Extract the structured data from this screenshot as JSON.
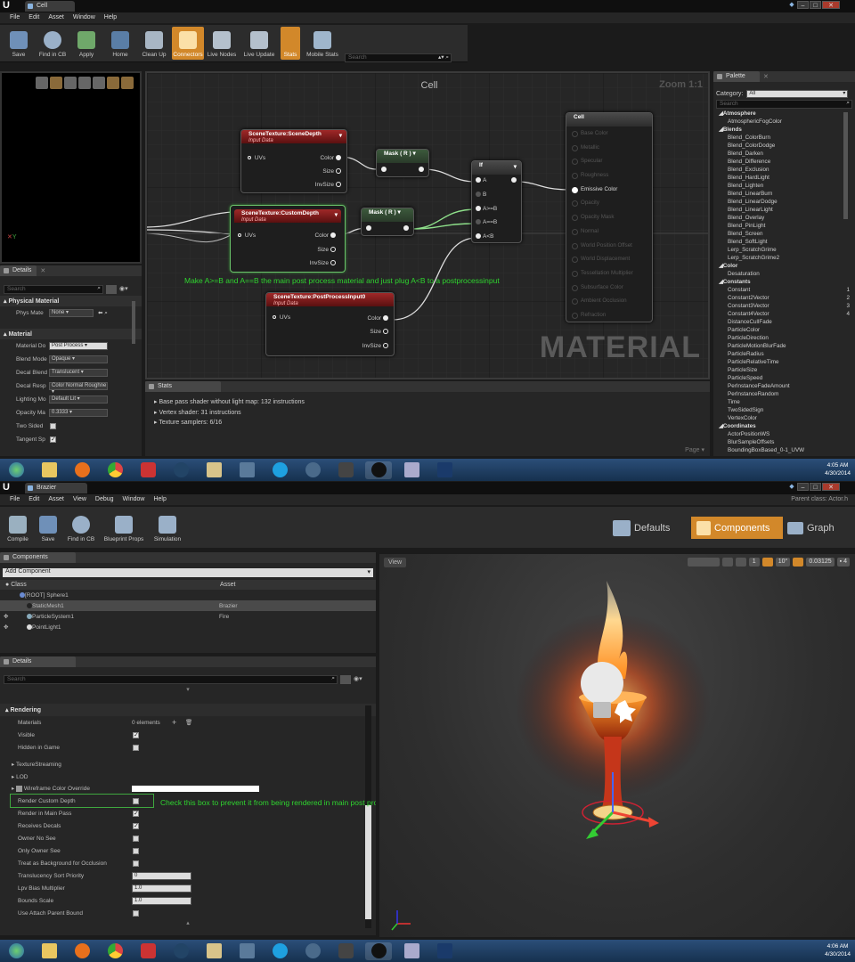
{
  "top": {
    "tab_title": "Cell",
    "menu": [
      "File",
      "Edit",
      "Asset",
      "Window",
      "Help"
    ],
    "toolbar": [
      "Save",
      "Find in CB",
      "Apply",
      "Home",
      "Clean Up",
      "Connectors",
      "Live Nodes",
      "Live Update",
      "Stats",
      "Mobile Stats"
    ],
    "toolbar_search_placeholder": "Search",
    "graph_title": "Cell",
    "zoom": "Zoom 1:1",
    "watermark": "MATERIAL",
    "annotation": "Make A>=B and A==B the main post process material and just plug A<B to a postprocessinput",
    "nodes": {
      "scene_depth": {
        "title": "SceneTexture:SceneDepth",
        "sub": "Input Data",
        "pins": [
          "UVs",
          "Color",
          "Size",
          "InvSize"
        ]
      },
      "custom_depth": {
        "title": "SceneTexture:CustomDepth",
        "sub": "Input Data",
        "pins": [
          "UVs",
          "Color",
          "Size",
          "InvSize"
        ]
      },
      "post_process": {
        "title": "SceneTexture:PostProcessInput0",
        "sub": "Input Data",
        "pins": [
          "UVs",
          "Color",
          "Size",
          "InvSize"
        ]
      },
      "mask1": {
        "title": "Mask ( R )"
      },
      "mask2": {
        "title": "Mask ( R )"
      },
      "if": {
        "title": "If",
        "pins": [
          "A",
          "B",
          "A>=B",
          "A==B",
          "A<B"
        ]
      },
      "cell": {
        "title": "Cell",
        "pins": [
          "Base Color",
          "Metallic",
          "Specular",
          "Roughness",
          "Emissive Color",
          "Opacity",
          "Opacity Mask",
          "Normal",
          "World Position Offset",
          "World Displacement",
          "Tessellation Multiplier",
          "Subsurface Color",
          "Ambient Occlusion",
          "Refraction"
        ]
      }
    },
    "details": {
      "tab": "Details",
      "search_placeholder": "Search",
      "cat_physical": "Physical Material",
      "phys_label": "Phys Mate",
      "phys_value": "None",
      "cat_material": "Material",
      "rows": [
        {
          "label": "Material Do",
          "value": "Post Process"
        },
        {
          "label": "Blend Mode",
          "value": "Opaque"
        },
        {
          "label": "Decal Blend",
          "value": "Translucent"
        },
        {
          "label": "Decal Resp",
          "value": "Color Normal Roughne"
        },
        {
          "label": "Lighting Mo",
          "value": "Default Lit"
        },
        {
          "label": "Opacity Ma",
          "value": "0.3333"
        },
        {
          "label": "Two Sided",
          "value": ""
        },
        {
          "label": "Tangent Sp",
          "value": ""
        }
      ]
    },
    "stats": {
      "tab": "Stats",
      "lines": [
        "Base pass shader without light map: 132 instructions",
        "Vertex shader: 31 instructions",
        "Texture samplers: 6/16"
      ],
      "page": "Page"
    },
    "palette": {
      "tab": "Palette",
      "category_label": "Category:",
      "category_value": "All",
      "search_placeholder": "Search",
      "items": [
        {
          "t": "Atmosphere",
          "cat": true
        },
        {
          "t": "AtmosphericFogColor"
        },
        {
          "t": "Blends",
          "cat": true
        },
        {
          "t": "Blend_ColorBurn"
        },
        {
          "t": "Blend_ColorDodge"
        },
        {
          "t": "Blend_Darken"
        },
        {
          "t": "Blend_Difference"
        },
        {
          "t": "Blend_Exclusion"
        },
        {
          "t": "Blend_HardLight"
        },
        {
          "t": "Blend_Lighten"
        },
        {
          "t": "Blend_LinearBurn"
        },
        {
          "t": "Blend_LinearDodge"
        },
        {
          "t": "Blend_LinearLight"
        },
        {
          "t": "Blend_Overlay"
        },
        {
          "t": "Blend_PinLight"
        },
        {
          "t": "Blend_Screen"
        },
        {
          "t": "Blend_SoftLight"
        },
        {
          "t": "Lerp_ScratchGrime"
        },
        {
          "t": "Lerp_ScratchGrime2"
        },
        {
          "t": "Color",
          "cat": true
        },
        {
          "t": "Desaturation"
        },
        {
          "t": "Constants",
          "cat": true
        },
        {
          "t": "Constant",
          "k": "1"
        },
        {
          "t": "Constant2Vector",
          "k": "2"
        },
        {
          "t": "Constant3Vector",
          "k": "3"
        },
        {
          "t": "Constant4Vector",
          "k": "4"
        },
        {
          "t": "DistanceCullFade"
        },
        {
          "t": "ParticleColor"
        },
        {
          "t": "ParticleDirection"
        },
        {
          "t": "ParticleMotionBlurFade"
        },
        {
          "t": "ParticleRadius"
        },
        {
          "t": "ParticleRelativeTime"
        },
        {
          "t": "ParticleSize"
        },
        {
          "t": "ParticleSpeed"
        },
        {
          "t": "PerInstanceFadeAmount"
        },
        {
          "t": "PerInstanceRandom"
        },
        {
          "t": "Time"
        },
        {
          "t": "TwoSidedSign"
        },
        {
          "t": "VertexColor"
        },
        {
          "t": "Coordinates",
          "cat": true
        },
        {
          "t": "ActorPositionWS"
        },
        {
          "t": "BlurSampleOffsets"
        },
        {
          "t": "BoundingBoxBased_0-1_UVW"
        }
      ]
    },
    "clock": {
      "time": "4:05 AM",
      "date": "4/30/2014"
    }
  },
  "bottom": {
    "tab_title": "Brazier",
    "parent_class": "Parent class: Actor.h",
    "menu": [
      "File",
      "Edit",
      "Asset",
      "View",
      "Debug",
      "Window",
      "Help"
    ],
    "toolbar": [
      "Compile",
      "Save",
      "Find in CB",
      "Blueprint Props",
      "Simulation"
    ],
    "modes": [
      "Defaults",
      "Components",
      "Graph"
    ],
    "components": {
      "tab": "Components",
      "add": "Add Component",
      "col_class": "Class",
      "col_asset": "Asset",
      "tree": [
        {
          "name": "[ROOT] Sphere1",
          "asset": ""
        },
        {
          "name": "StaticMesh1",
          "asset": "Brazier"
        },
        {
          "name": "ParticleSystem1",
          "asset": "Fire"
        },
        {
          "name": "PointLight1",
          "asset": ""
        }
      ]
    },
    "details": {
      "tab": "Details",
      "search_placeholder": "Search",
      "cat": "Rendering",
      "materials_label": "Materials",
      "materials_value": "0 elements",
      "rows": [
        {
          "label": "Visible",
          "check": true
        },
        {
          "label": "Hidden in Game",
          "check": false
        }
      ],
      "groups": [
        "TextureStreaming",
        "LOD",
        "Wireframe Color Override"
      ],
      "rows2": [
        {
          "label": "Render Custom Depth",
          "check": false
        },
        {
          "label": "Render in Main Pass",
          "check": true
        },
        {
          "label": "Receives Decals",
          "check": true
        },
        {
          "label": "Owner No See",
          "check": false
        },
        {
          "label": "Only Owner See",
          "check": false
        },
        {
          "label": "Treat as Background for Occlusion",
          "check": false
        }
      ],
      "nums": [
        {
          "label": "Translucency Sort Priority",
          "value": "0"
        },
        {
          "label": "Lpv Bias Multiplier",
          "value": "1.0"
        },
        {
          "label": "Bounds Scale",
          "value": "1.0"
        }
      ],
      "last": "Use Attach Parent Bound",
      "annotation": "Check this box to prevent it from being rendered in main post process"
    },
    "viewport": {
      "tab": "View",
      "angle": "10°",
      "scale": "0.03125",
      "cam": "4"
    },
    "clock": {
      "time": "4:06 AM",
      "date": "4/30/2014"
    }
  }
}
